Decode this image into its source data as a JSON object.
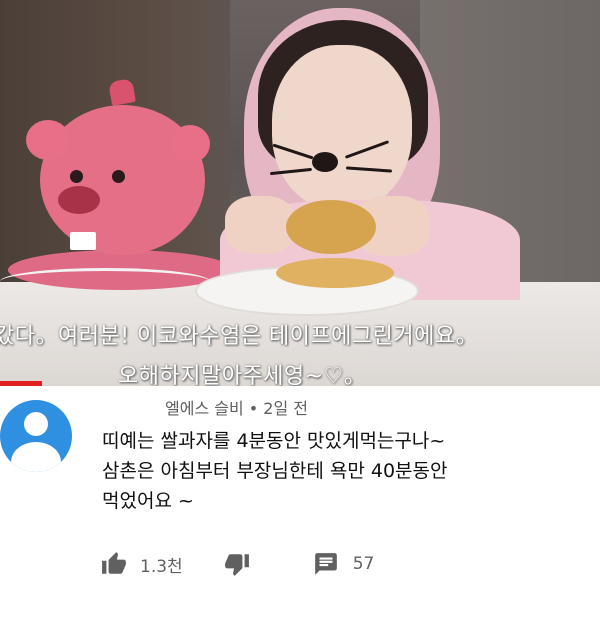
{
  "video": {
    "subtitle_line1": "갔다。여러분! 이코와수염은 테이프에그린거에요。",
    "subtitle_line2": "오해하지말아주세영~♡。",
    "progress_fraction": 0.07,
    "progress_color": "#e02020"
  },
  "comment": {
    "author": "엘에스 슬비",
    "separator": " • ",
    "time": "2일 전",
    "text": "띠예는 쌀과자를 4분동안 맛있게먹는구나~\n삼촌은 아침부터 부장님한테 욕만 40분동안\n먹었어요 ~",
    "avatar_color": "#2f8fe0",
    "likes": "1.3천",
    "replies": "57",
    "icons": {
      "like": "thumbs-up-icon",
      "dislike": "thumbs-down-icon",
      "reply": "comment-bubble-icon"
    }
  }
}
